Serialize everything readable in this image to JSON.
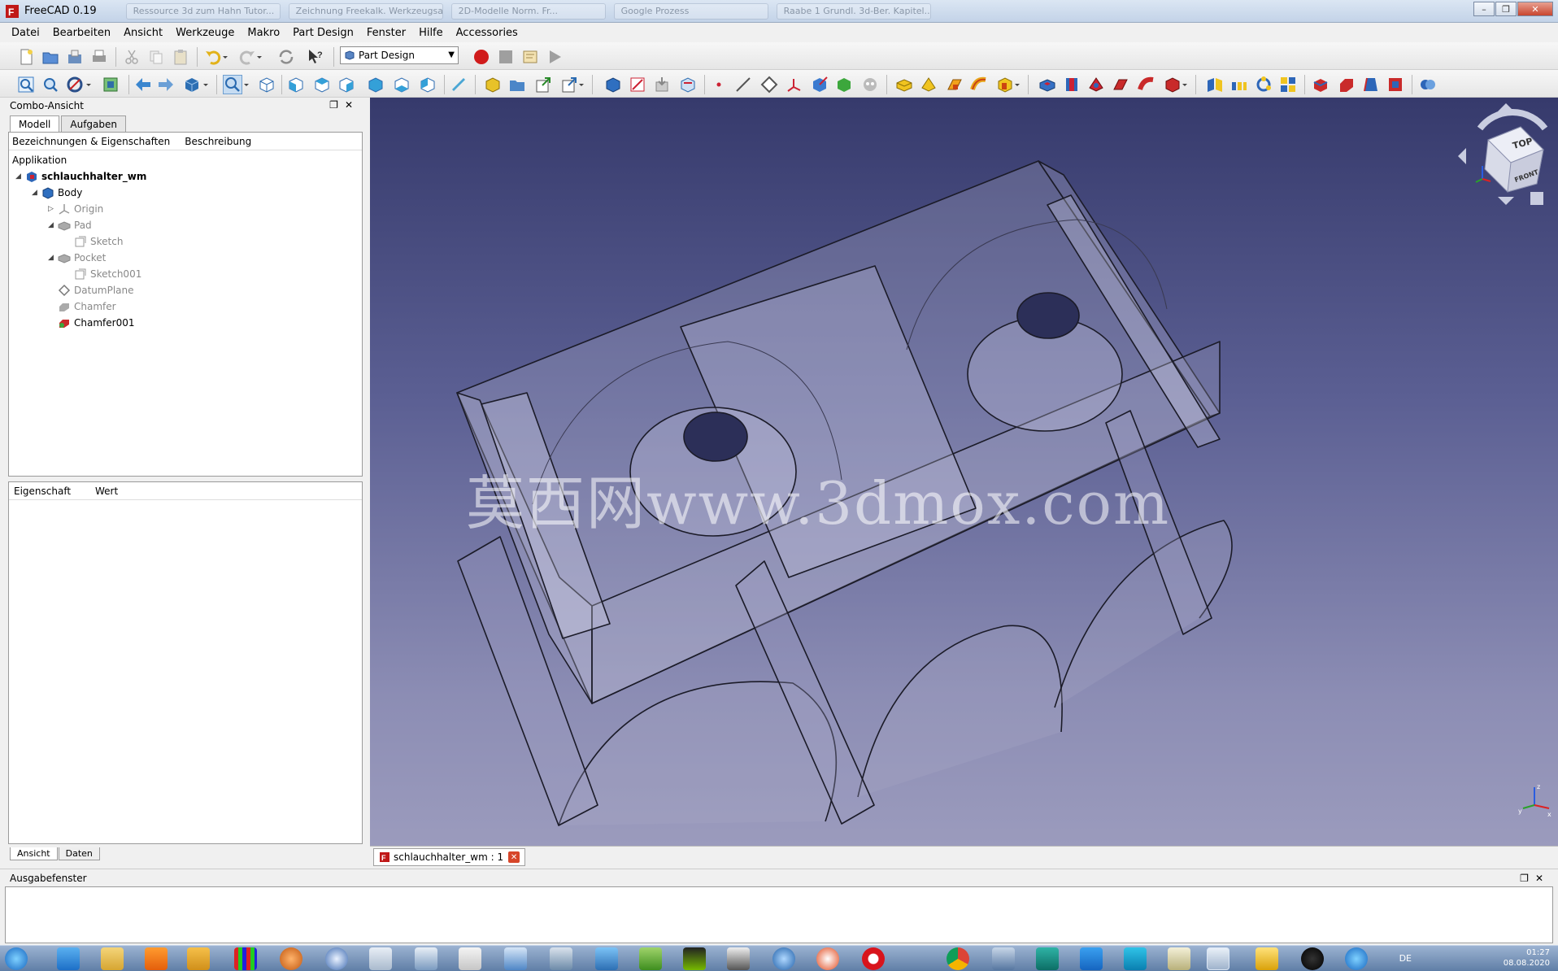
{
  "window": {
    "title": "FreeCAD 0.19",
    "background_tabs": [
      "Ressource 3d zum Hahn Tutor...",
      "Zeichnung Freekalk. Werkzeugsat...",
      "2D-Modelle Norm. Fr...",
      "Google Prozess",
      "Raabe 1 Grundl. 3d-Ber. Kapitel...",
      ""
    ]
  },
  "menu": {
    "items": [
      "Datei",
      "Bearbeiten",
      "Ansicht",
      "Werkzeuge",
      "Makro",
      "Part Design",
      "Fenster",
      "Hilfe",
      "Accessories"
    ]
  },
  "toolbar": {
    "workbench": "Part Design"
  },
  "combo": {
    "title": "Combo-Ansicht",
    "tabs": [
      "Modell",
      "Aufgaben"
    ],
    "tree_columns": [
      "Bezeichnungen & Eigenschaften",
      "Beschreibung"
    ],
    "tree_root_label": "Applikation",
    "tree": {
      "document": "schlauchhalter_wm",
      "body": "Body",
      "origin": "Origin",
      "pad": "Pad",
      "sketch": "Sketch",
      "pocket": "Pocket",
      "sketch001": "Sketch001",
      "datumplane": "DatumPlane",
      "chamfer": "Chamfer",
      "chamfer001": "Chamfer001"
    },
    "property_columns": [
      "Eigenschaft",
      "Wert"
    ],
    "property_tabs": [
      "Ansicht",
      "Daten"
    ]
  },
  "view3d": {
    "watermark": "莫西网www.3dmox.com",
    "navcube_top": "TOP",
    "navcube_front": "FRONT",
    "doc_tab": "schlauchhalter_wm : 1"
  },
  "report": {
    "title": "Ausgabefenster"
  },
  "taskbar": {
    "language": "DE",
    "time": "01:27",
    "date": "08.08.2020"
  }
}
